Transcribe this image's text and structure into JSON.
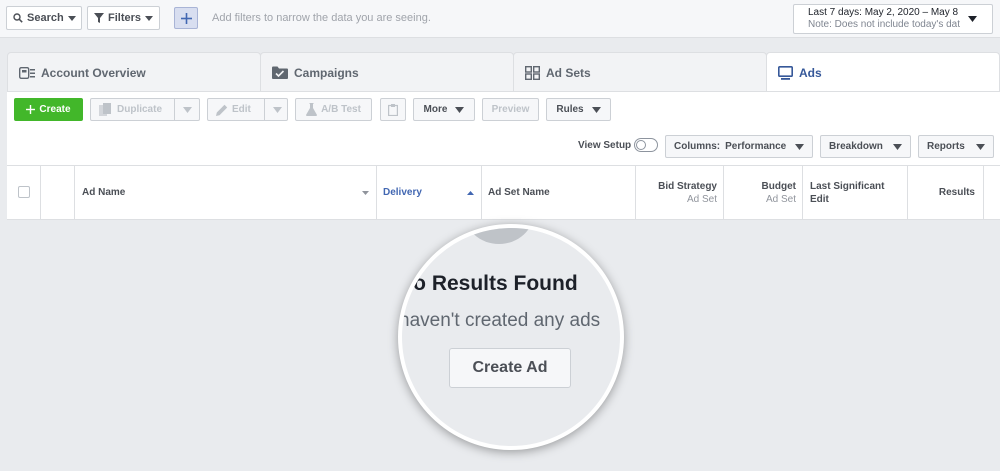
{
  "filterbar": {
    "search_label": "Search",
    "filters_label": "Filters",
    "hint": "Add filters to narrow the data you are seeing.",
    "date_range": "Last 7 days: May 2, 2020 – May 8",
    "date_note": "Note: Does not include today's dat"
  },
  "tabs": [
    {
      "label": "Account Overview",
      "icon": "account-overview-icon"
    },
    {
      "label": "Campaigns",
      "icon": "folder-icon"
    },
    {
      "label": "Ad Sets",
      "icon": "grid-icon"
    },
    {
      "label": "Ads",
      "icon": "ad-icon"
    }
  ],
  "toolbar": {
    "create": "Create",
    "duplicate": "Duplicate",
    "edit": "Edit",
    "ab_test": "A/B Test",
    "more": "More",
    "preview": "Preview",
    "rules": "Rules"
  },
  "viewbar": {
    "view_setup": "View Setup",
    "columns_prefix": "Columns:",
    "columns_value": "Performance",
    "breakdown": "Breakdown",
    "reports": "Reports"
  },
  "table": {
    "headers": {
      "ad_name": "Ad Name",
      "delivery": "Delivery",
      "ad_set_name": "Ad Set Name",
      "bid_strategy": "Bid Strategy",
      "bid_strategy_sub": "Ad Set",
      "budget": "Budget",
      "budget_sub": "Ad Set",
      "last_edit_1": "Last Significant",
      "last_edit_2": "Edit",
      "results": "Results"
    }
  },
  "empty_state": {
    "title": "No Results Found",
    "subtitle": "haven't created any ads",
    "button": "Create Ad"
  },
  "colors": {
    "accent_green": "#42b72a",
    "link_blue": "#365899",
    "sort_blue": "#4267b2"
  }
}
